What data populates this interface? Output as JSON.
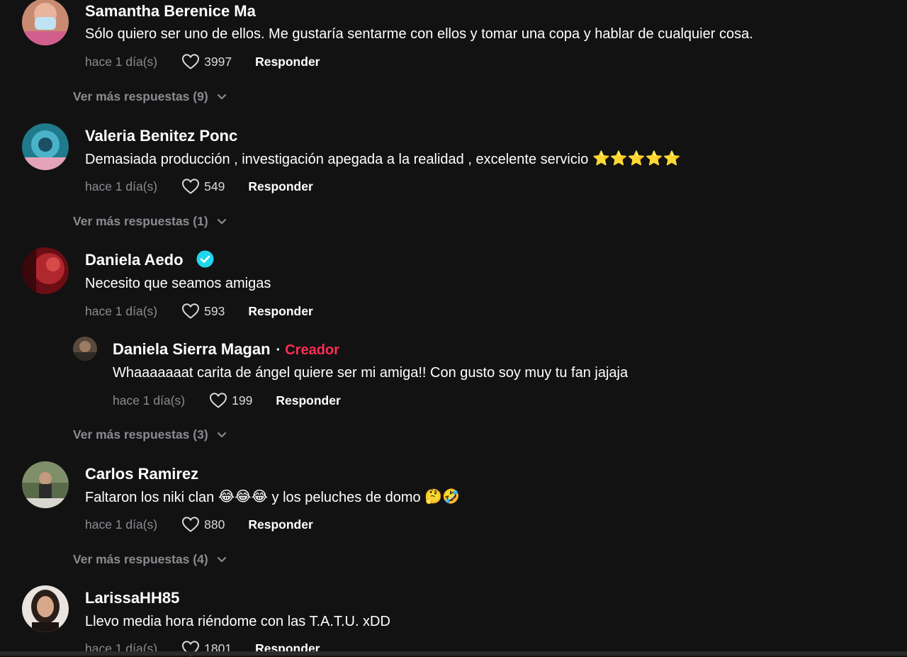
{
  "comments": [
    {
      "username": "Samantha Berenice Ma",
      "text": "Sólo quiero ser uno de ellos. Me gustaría sentarme con ellos y tomar una copa y hablar de cualquier cosa.",
      "time": "hace 1 día(s)",
      "likes": "3997",
      "reply_label": "Responder",
      "more_replies": "Ver más respuestas (9)"
    },
    {
      "username": "Valeria Benitez Ponc",
      "text": "Demasiada producción , investigación apegada a la realidad , excelente servicio",
      "emoji": "⭐⭐⭐⭐⭐",
      "time": "hace 1 día(s)",
      "likes": "549",
      "reply_label": "Responder",
      "more_replies": "Ver más respuestas (1)"
    },
    {
      "username": "Daniela Aedo",
      "text": "Necesito que seamos amigas",
      "time": "hace 1 día(s)",
      "likes": "593",
      "reply_label": "Responder",
      "reply": {
        "username": "Daniela Sierra Magan",
        "separator": "·",
        "badge": "Creador",
        "text": "Whaaaaaaat carita de ángel quiere ser mi amiga!! Con gusto soy muy tu fan jajaja",
        "time": "hace 1 día(s)",
        "likes": "199",
        "reply_label": "Responder"
      },
      "more_replies": "Ver más respuestas (3)"
    },
    {
      "username": "Carlos Ramirez",
      "text_a": "Faltaron los niki clan",
      "emoji_a": "😂😂😂",
      "text_b": "y los peluches de domo",
      "emoji_b": "🤔🤣",
      "time": "hace 1 día(s)",
      "likes": "880",
      "reply_label": "Responder",
      "more_replies": "Ver más respuestas (4)"
    },
    {
      "username": "LarissaHH85",
      "text": "Llevo media hora riéndome con las T.A.T.U. xDD",
      "time": "hace 1 día(s)",
      "likes": "1801",
      "reply_label": "Responder"
    }
  ],
  "colors": {
    "background": "#121212",
    "secondary_text": "#8a8b91",
    "creator_badge": "#fe2c55",
    "verified": "#20d5ec"
  },
  "icons": [
    "heart-outline-icon",
    "chevron-down-icon",
    "verified-badge-icon",
    "star-emoji"
  ]
}
